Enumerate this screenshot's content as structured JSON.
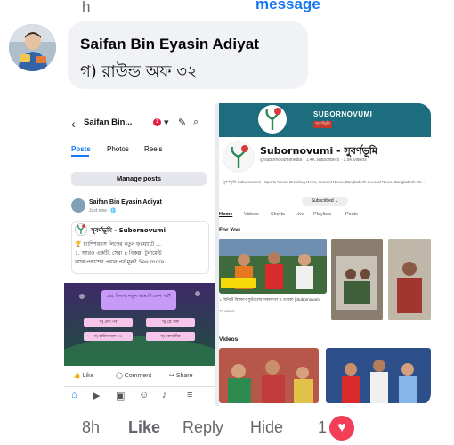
{
  "top": {
    "h": "h",
    "message": "message",
    "edge": "¦"
  },
  "comment": {
    "author": "Saifan Bin Eyasin Adiyat",
    "text": "গ) রাউন্ড অফ ৩২"
  },
  "actions": {
    "time": "8h",
    "like": "Like",
    "reply": "Reply",
    "hide": "Hide",
    "reaction_count": "1",
    "reaction_icon": "heart-icon",
    "heart_color": "#f33e58"
  },
  "attachment": {
    "phone": {
      "back_glyph": "‹",
      "title": "Saifan Bin...",
      "badge": "1",
      "tabs": [
        "Posts",
        "Photos",
        "Reels"
      ],
      "manage_posts": "Manage posts",
      "post_author": "Saifan Bin Eyasin Adiyat",
      "post_time": "Just now · 🌐",
      "card_title": "সুবর্ণভূমি - Subornovumi",
      "card_lines": [
        "🏆 চ্যাম্পিয়নস লিগের নতুন ফরম্যাটে ...",
        "১. আরও একটি, সেরা ৪ বিকল্প: টুর্নামেন্ট",
        "আত্মপ্রকাশের প্রধান পর্ব মূল?"
      ],
      "see_more": "See more",
      "quiz_question": "প্রশ্ন: ফিফার নতুন ফরম্যাট কোন পর্ব?",
      "quiz_options": [
        "ক) গ্রুপ পর্ব",
        "খ) প্লে অফ",
        "গ) রাউন্ড অফ ৩২",
        "ঘ) কোয়ার্টার"
      ],
      "reactions": [
        "Like",
        "Comment",
        "Share"
      ]
    },
    "youtube": {
      "banner_title": "SUBORNOVUMI",
      "banner_sub": "সুবর্ণভূমি",
      "channel": "Subornovumi - সুবর্ণভূমি",
      "handle": "@subornovumimedia · 1.4K subscribers · 1.9K videos",
      "description": "সুবর্ণভূমি Subornovumi · Sports News, Breaking News, Current News, Bangladesh & Local News, Bangladesh Wi...",
      "subscribed": "Subscribed ⌄",
      "tabs": [
        "Home",
        "Videos",
        "Shorts",
        "Live",
        "Playlists",
        "Posts"
      ],
      "for_you": "For You",
      "video_caption": "১ মিনিটে বিশ্বকাপ ফুটবলের সকল দল ও তারকা | Subornovumi",
      "video_meta": "27 views",
      "videos_label": "Videos"
    }
  }
}
